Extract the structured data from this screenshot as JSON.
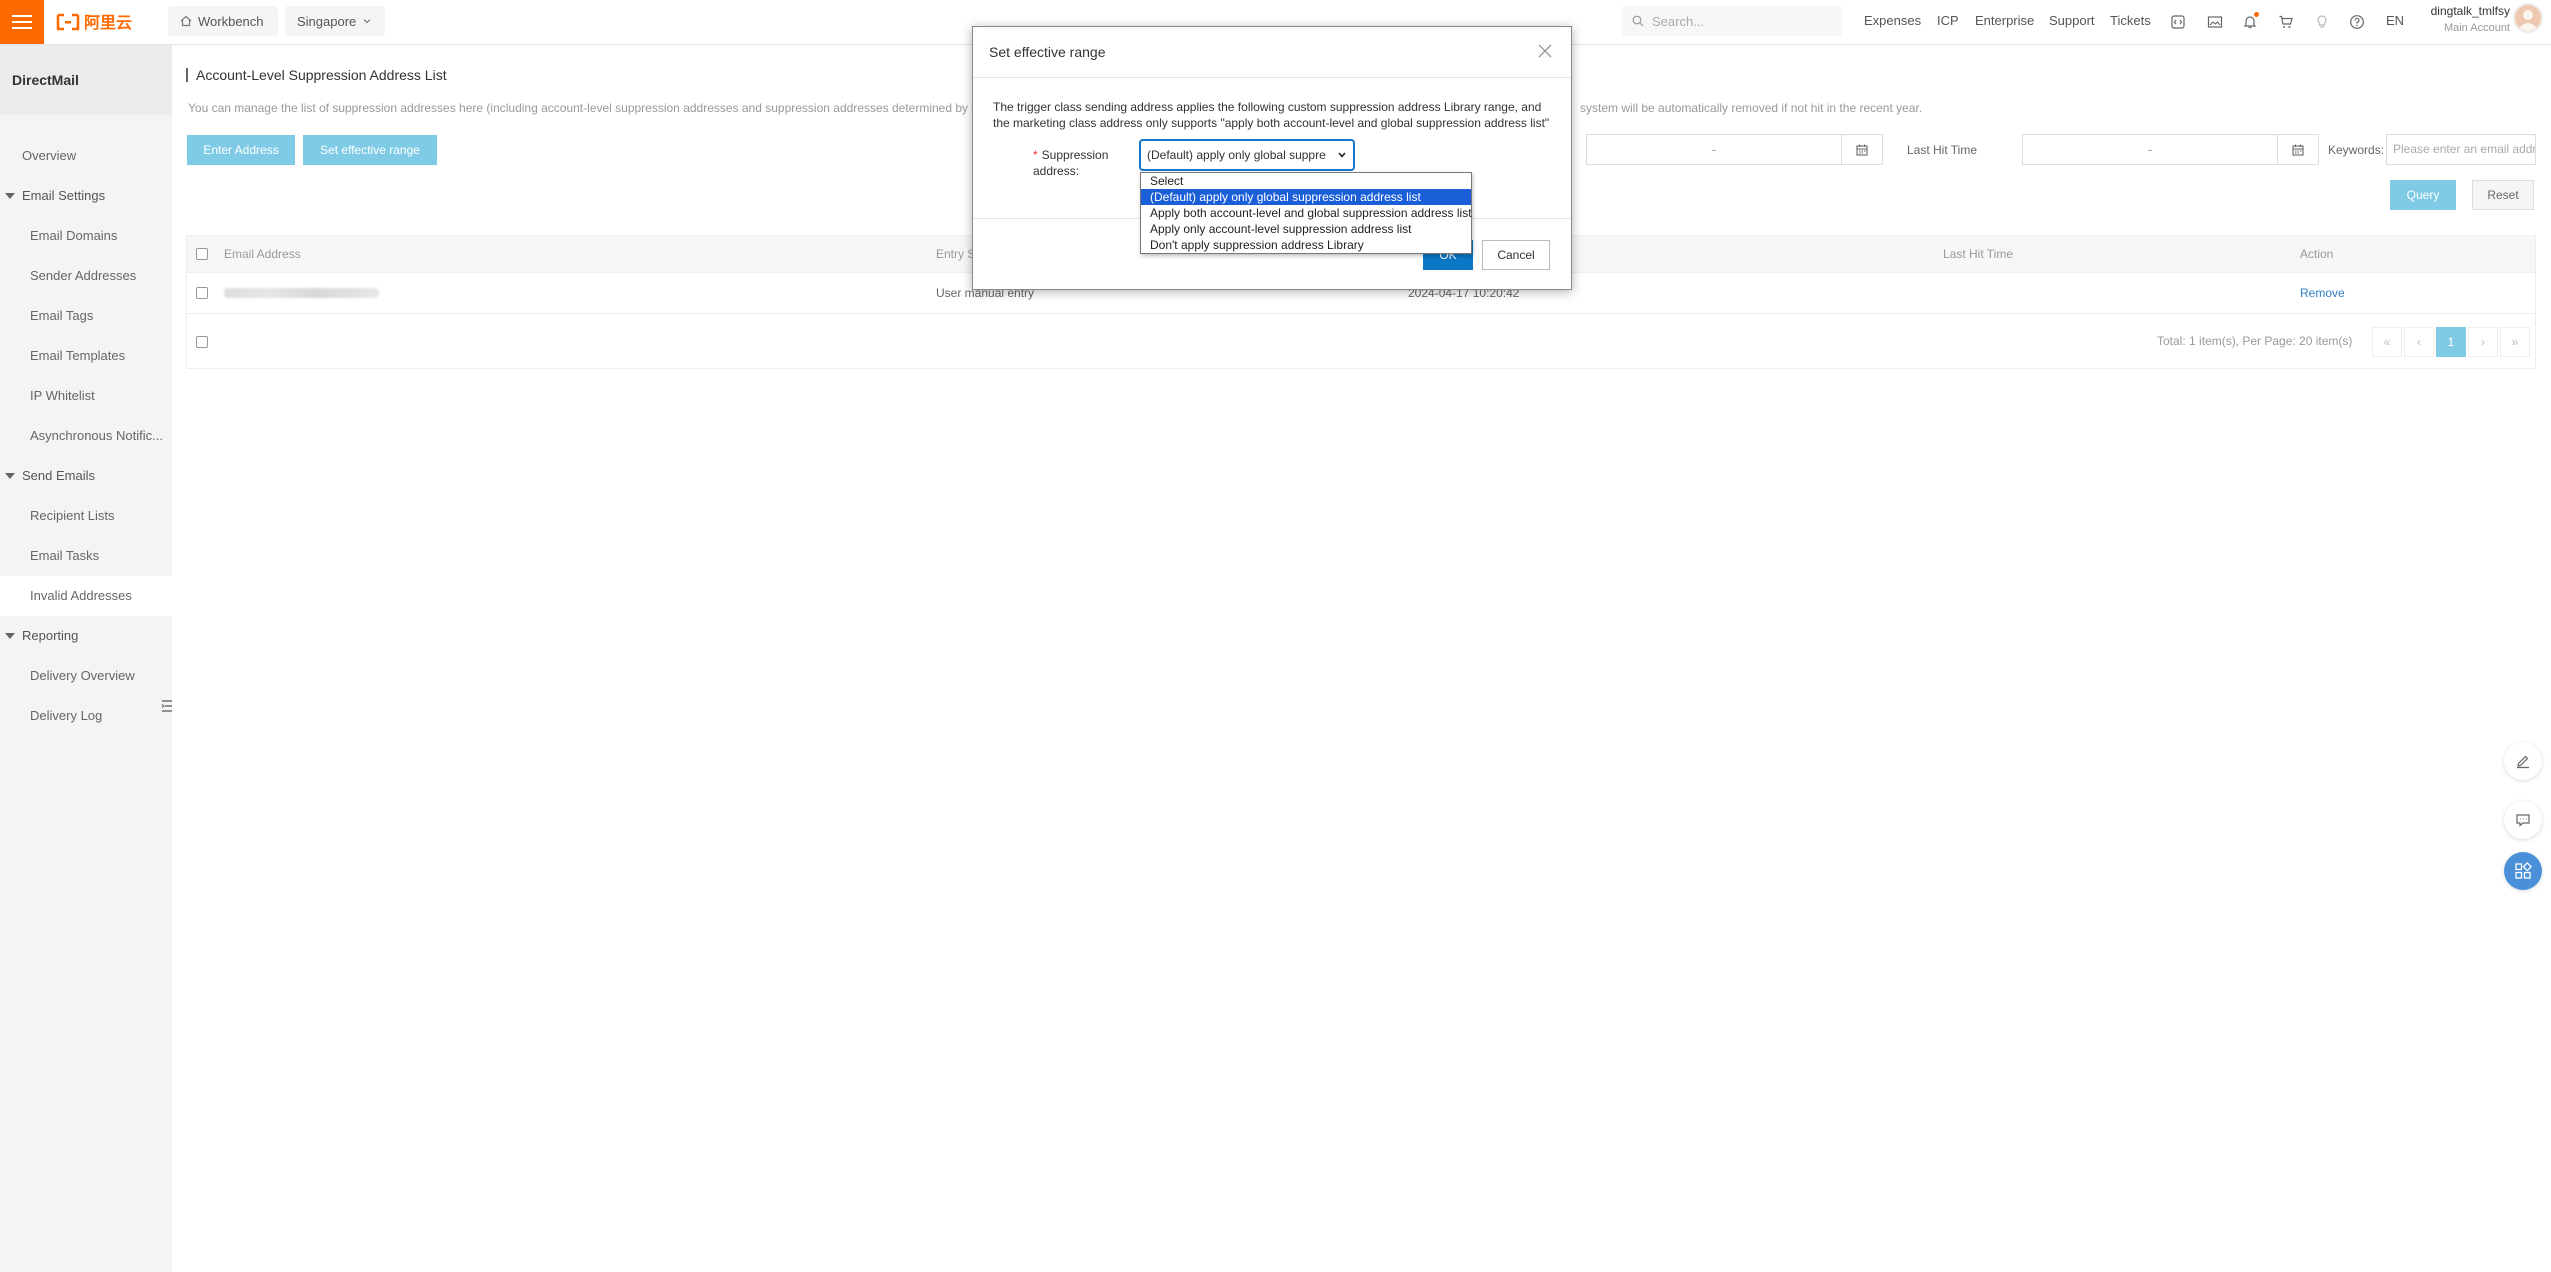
{
  "topbar": {
    "workbench": "Workbench",
    "region": "Singapore",
    "search_placeholder": "Search...",
    "links": [
      "Expenses",
      "ICP",
      "Enterprise",
      "Support",
      "Tickets"
    ],
    "lang": "EN",
    "user_name": "dingtalk_tmlfsy",
    "user_role": "Main Account"
  },
  "sidebar": {
    "title": "DirectMail",
    "items": [
      {
        "label": "Overview"
      },
      {
        "label": "Email Settings"
      },
      {
        "label": "Email Domains"
      },
      {
        "label": "Sender Addresses"
      },
      {
        "label": "Email Tags"
      },
      {
        "label": "Email Templates"
      },
      {
        "label": "IP Whitelist"
      },
      {
        "label": "Asynchronous Notific..."
      },
      {
        "label": "Send Emails"
      },
      {
        "label": "Recipient Lists"
      },
      {
        "label": "Email Tasks"
      },
      {
        "label": "Invalid Addresses"
      },
      {
        "label": "Reporting"
      },
      {
        "label": "Delivery Overview"
      },
      {
        "label": "Delivery Log"
      }
    ]
  },
  "main": {
    "page_title": "Account-Level Suppression Address List",
    "description": "You can manage the list of suppression addresses here (including account-level suppression addresses and suppression addresses determined by the",
    "description_tail": "system will be automatically removed if not hit in the recent year.",
    "enter_address_label": "Enter Address",
    "set_range_label": "Set effective range",
    "date_placeholder": "-",
    "last_hit_label": "Last Hit Time",
    "last_hit_placeholder": "-",
    "keywords_label": "Keywords:",
    "keywords_placeholder": "Please enter an email address",
    "query_label": "Query",
    "reset_label": "Reset",
    "table": {
      "headers": {
        "email": "Email Address",
        "entry": "Entry S",
        "last_hit": "Last Hit Time",
        "action": "Action"
      },
      "rows": [
        {
          "entry": "User manual entry",
          "time": "2024-04-17 10:20:42",
          "action": "Remove"
        }
      ],
      "pagination_text": "Total: 1 item(s), Per Page: 20 item(s)",
      "pages": [
        "«",
        "‹",
        "1",
        "›",
        "»"
      ],
      "current_page": "1"
    }
  },
  "modal": {
    "title": "Set effective range",
    "description": "The trigger class sending address applies the following custom suppression address Library range, and the marketing class address only supports \"apply both account-level and global suppression address list\"",
    "field_label": "Suppression address:",
    "selected_value": "(Default) apply only global suppre",
    "options": [
      "Select",
      "(Default) apply only global suppression address list",
      "Apply both account-level and global suppression address list",
      "Apply only account-level suppression address list",
      "Don't apply suppression address Library"
    ],
    "highlighted_option": 1,
    "ok_label": "OK",
    "cancel_label": "Cancel"
  },
  "colors": {
    "brand": "#ff6a00",
    "primary_button": "#7fcbe6",
    "ok_button": "#0a77c7",
    "link": "#2e7fc8",
    "dropdown_highlight": "#1a5fd8"
  },
  "icons": [
    "menu-icon",
    "home-icon",
    "chevron-down-icon",
    "search-icon",
    "code-icon",
    "image-icon",
    "bell-icon",
    "cart-icon",
    "bulb-icon",
    "help-icon",
    "close-icon",
    "calendar-icon",
    "edit-icon",
    "chat-icon",
    "apps-icon",
    "list-collapse-icon"
  ]
}
